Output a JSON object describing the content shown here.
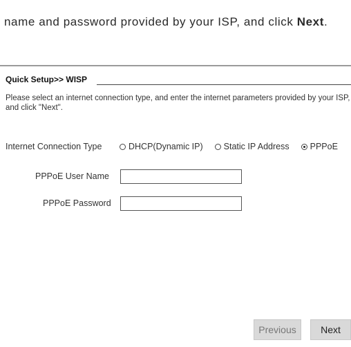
{
  "intro": {
    "text": "name and password provided by your ISP, and click ",
    "emphasis": "Next",
    "end": "."
  },
  "section": {
    "title": "Quick Setup>> WISP"
  },
  "description": {
    "line1": "Please select an internet connection type, and enter the internet parameters provided by your ISP,",
    "line2": "and click \"Next\"."
  },
  "connection": {
    "label": "Internet Connection Type",
    "options": [
      {
        "label": "DHCP(Dynamic IP)",
        "checked": false
      },
      {
        "label": "Static IP Address",
        "checked": false
      },
      {
        "label": "PPPoE",
        "checked": true
      }
    ]
  },
  "fields": {
    "username_label": "PPPoE User Name",
    "username_value": "",
    "password_label": "PPPoE Password",
    "password_value": ""
  },
  "buttons": {
    "previous": "Previous",
    "next": "Next"
  }
}
